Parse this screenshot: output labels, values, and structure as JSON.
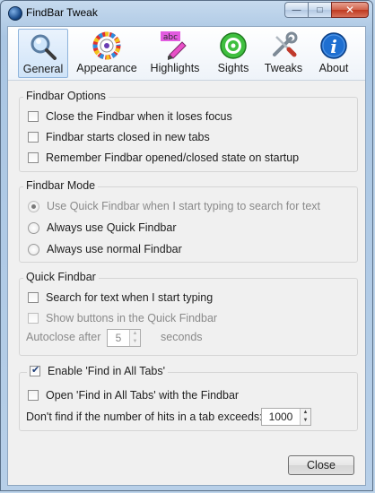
{
  "window": {
    "title": "FindBar Tweak"
  },
  "toolbar": {
    "tabs": [
      {
        "label": "General",
        "icon": "magnifier-icon",
        "selected": true
      },
      {
        "label": "Appearance",
        "icon": "color-wheel-icon",
        "selected": false
      },
      {
        "label": "Highlights",
        "icon": "highlighter-marker-icon",
        "badge": "abc",
        "selected": false
      },
      {
        "label": "Sights",
        "icon": "target-icon",
        "selected": false
      },
      {
        "label": "Tweaks",
        "icon": "wrench-screwdriver-icon",
        "selected": false
      },
      {
        "label": "About",
        "icon": "info-icon",
        "selected": false
      }
    ]
  },
  "findbar_options": {
    "title": "Findbar Options",
    "close_on_focus_loss": {
      "label": "Close the Findbar when it loses focus",
      "checked": false
    },
    "starts_closed": {
      "label": "Findbar starts closed in new tabs",
      "checked": false
    },
    "remember_state": {
      "label": "Remember Findbar opened/closed state on startup",
      "checked": false
    }
  },
  "findbar_mode": {
    "title": "Findbar Mode",
    "quick_when_typing": {
      "label": "Use Quick Findbar when I start typing to search for text",
      "checked": true,
      "disabled": true
    },
    "always_quick": {
      "label": "Always use Quick Findbar",
      "checked": false
    },
    "always_normal": {
      "label": "Always use normal Findbar",
      "checked": false
    }
  },
  "quick_findbar": {
    "title": "Quick Findbar",
    "search_when_typing": {
      "label": "Search for text when I start typing",
      "checked": false
    },
    "show_buttons": {
      "label": "Show buttons in the Quick Findbar",
      "checked": false,
      "disabled": true
    },
    "autoclose_label": "Autoclose after",
    "autoclose_value": "5",
    "autoclose_unit": "seconds"
  },
  "find_all_tabs": {
    "enable": {
      "label": "Enable 'Find in All Tabs'",
      "checked": true
    },
    "open_with_findbar": {
      "label": "Open 'Find in All Tabs' with the Findbar",
      "checked": false
    },
    "limit_label": "Don't find if the number of hits in a tab exceeds:",
    "limit_value": "1000"
  },
  "footer": {
    "close_label": "Close"
  },
  "colors": {
    "selected_tab_bg": "#cfe3f8",
    "window_frame": "#aac6e3"
  }
}
